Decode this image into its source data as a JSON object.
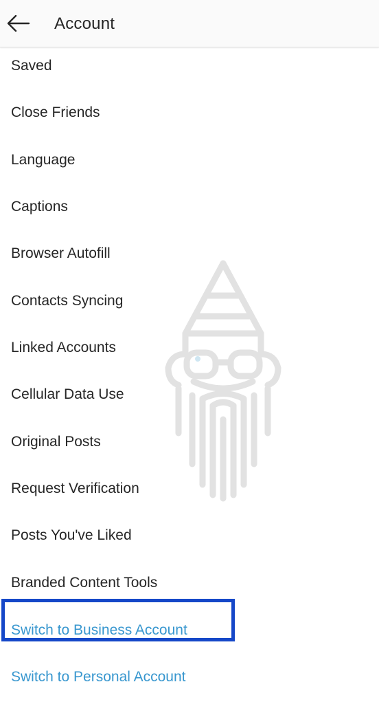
{
  "header": {
    "back_icon": "back-arrow-icon",
    "title": "Account"
  },
  "menu": {
    "items": [
      {
        "label": "Saved",
        "type": "setting"
      },
      {
        "label": "Close Friends",
        "type": "setting"
      },
      {
        "label": "Language",
        "type": "setting"
      },
      {
        "label": "Captions",
        "type": "setting"
      },
      {
        "label": "Browser Autofill",
        "type": "setting"
      },
      {
        "label": "Contacts Syncing",
        "type": "setting"
      },
      {
        "label": "Linked Accounts",
        "type": "setting"
      },
      {
        "label": "Cellular Data Use",
        "type": "setting"
      },
      {
        "label": "Original Posts",
        "type": "setting"
      },
      {
        "label": "Request Verification",
        "type": "setting"
      },
      {
        "label": "Posts You've Liked",
        "type": "setting"
      },
      {
        "label": "Branded Content Tools",
        "type": "setting"
      },
      {
        "label": "Switch to Business Account",
        "type": "link"
      },
      {
        "label": "Switch to Personal Account",
        "type": "link"
      }
    ]
  },
  "highlighted_item": "Switch to Personal Account",
  "colors": {
    "text": "#262626",
    "link": "#3897cf",
    "highlight_border": "#1547c8",
    "header_bg": "#fafafa"
  }
}
